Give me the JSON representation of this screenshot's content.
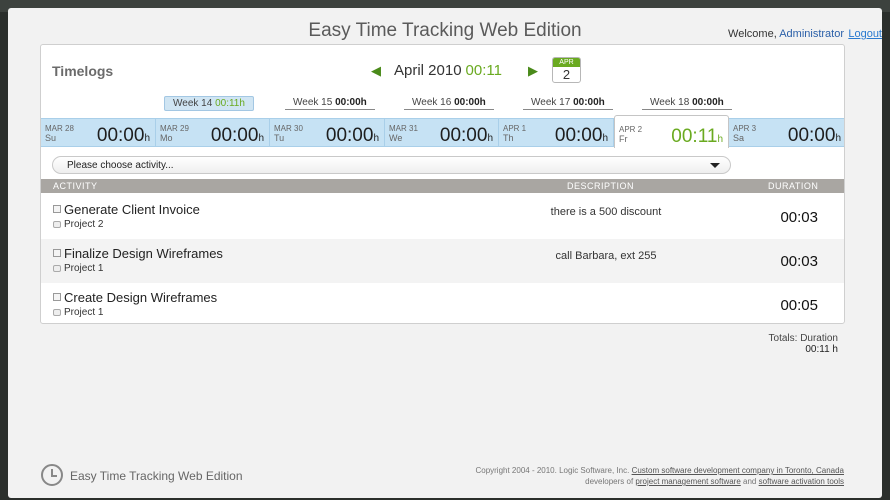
{
  "header": {
    "title": "Easy Time Tracking Web Edition",
    "welcome_label": "Welcome,",
    "user": "Administrator",
    "logout": "Logout"
  },
  "panel": {
    "title": "Timelogs",
    "month": "April 2010",
    "month_total": "00:11",
    "calendar_badge": {
      "month": "APR",
      "day": "2"
    },
    "prev_icon": "left-arrow-icon",
    "next_icon": "right-arrow-icon"
  },
  "weeks": [
    {
      "label": "Week 14",
      "total": "00:11h",
      "active": true
    },
    {
      "label": "Week 15",
      "total": "00:00h",
      "active": false
    },
    {
      "label": "Week 16",
      "total": "00:00h",
      "active": false
    },
    {
      "label": "Week 17",
      "total": "00:00h",
      "active": false
    },
    {
      "label": "Week 18",
      "total": "00:00h",
      "active": false
    }
  ],
  "days": [
    {
      "date": "MAR 28",
      "weekday": "Su",
      "total": "00:00",
      "unit": "h",
      "active": false
    },
    {
      "date": "MAR 29",
      "weekday": "Mo",
      "total": "00:00",
      "unit": "h",
      "active": false
    },
    {
      "date": "MAR 30",
      "weekday": "Tu",
      "total": "00:00",
      "unit": "h",
      "active": false
    },
    {
      "date": "MAR 31",
      "weekday": "We",
      "total": "00:00",
      "unit": "h",
      "active": false
    },
    {
      "date": "APR 1",
      "weekday": "Th",
      "total": "00:00",
      "unit": "h",
      "active": false
    },
    {
      "date": "APR 2",
      "weekday": "Fr",
      "total": "00:11",
      "unit": "h",
      "active": true
    },
    {
      "date": "APR 3",
      "weekday": "Sa",
      "total": "00:00",
      "unit": "h",
      "active": false
    }
  ],
  "activity_select": {
    "placeholder": "Please choose activity..."
  },
  "table": {
    "columns": {
      "activity": "ACTIVITY",
      "description": "DESCRIPTION",
      "duration": "DURATION"
    },
    "rows": [
      {
        "activity": "Generate Client Invoice",
        "project": "Project 2",
        "description": "there is a 500 discount",
        "duration": "00:03"
      },
      {
        "activity": "Finalize Design Wireframes",
        "project": "Project 1",
        "description": "call Barbara, ext 255",
        "duration": "00:03"
      },
      {
        "activity": "Create Design Wireframes",
        "project": "Project 1",
        "description": "",
        "duration": "00:05"
      }
    ]
  },
  "totals": {
    "label": "Totals: Duration",
    "value": "00:11 h"
  },
  "footer": {
    "app_name": "Easy Time Tracking Web Edition",
    "copyright": "Copyright 2004 - 2010. Logic Software, Inc.",
    "link1": "Custom software development company in Toronto, Canada",
    "developers_of": "developers of",
    "link2": "project management software",
    "and": "and",
    "link3": "software activation tools"
  },
  "colors": {
    "accent_green": "#6aaa20",
    "day_bar": "#c6e2f4",
    "header_gray": "#a9a6a2",
    "link_blue": "#2a7ad0"
  }
}
